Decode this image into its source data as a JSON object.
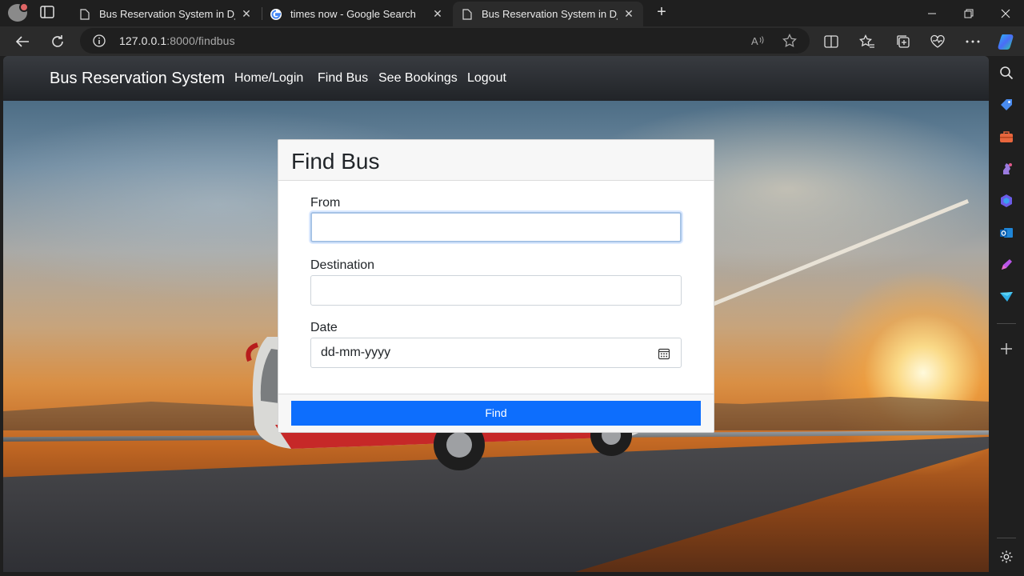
{
  "browser": {
    "tabs": [
      {
        "title": "Bus Reservation System in Django",
        "icon": "page-icon",
        "active": false
      },
      {
        "title": "times now - Google Search",
        "icon": "google-icon",
        "active": false
      },
      {
        "title": "Bus Reservation System in Django",
        "icon": "page-icon",
        "active": true
      }
    ],
    "close_glyph": "✕",
    "new_tab_glyph": "+",
    "url_host": "127.0.0.1",
    "url_rest": ":8000/findbus"
  },
  "navbar": {
    "brand": "Bus Reservation System",
    "links": [
      "Home/Login",
      "Find Bus",
      "See Bookings",
      "Logout"
    ]
  },
  "form": {
    "title": "Find Bus",
    "from_label": "From",
    "from_value": "",
    "destination_label": "Destination",
    "destination_value": "",
    "date_label": "Date",
    "date_placeholder": "dd-mm-yyyy",
    "submit_label": "Find"
  },
  "colors": {
    "primary": "#0d6efd",
    "navbar": "#212428"
  }
}
